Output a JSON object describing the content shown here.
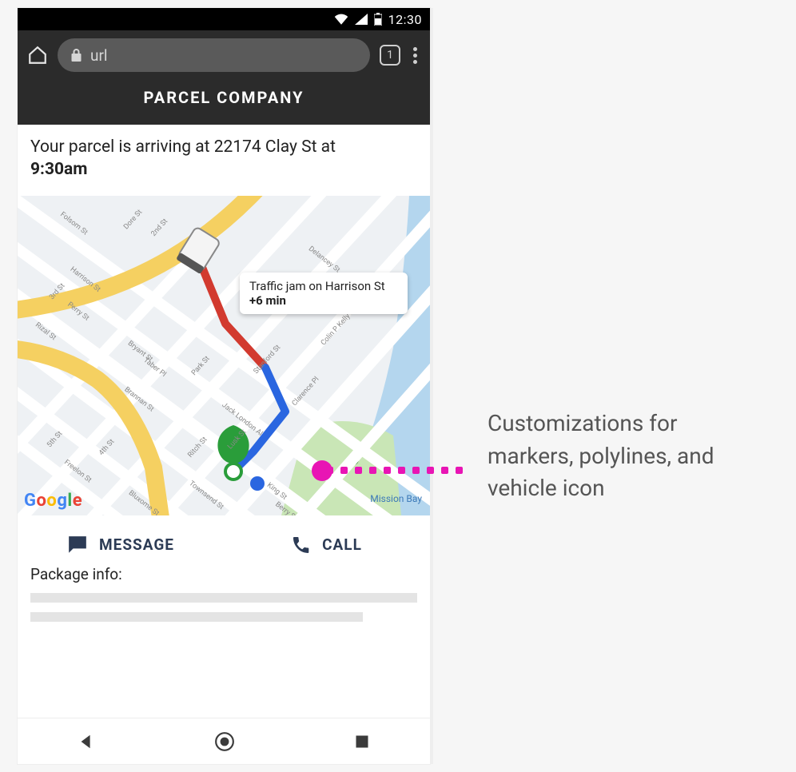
{
  "statusbar": {
    "time": "12:30"
  },
  "browser": {
    "url_placeholder": "url",
    "tab_count": "1"
  },
  "site": {
    "header": "PARCEL COMPANY"
  },
  "arrival": {
    "line1": "Your parcel is arriving at 22174 Clay St at",
    "time": "9:30am"
  },
  "map": {
    "traffic_alert_text": "Traffic jam on Harrison St",
    "traffic_delay": "+6 min",
    "logo": "Google",
    "area_label": "Mission Bay",
    "streets": [
      "Folsom St",
      "Dore St",
      "2nd St",
      "Harrison St",
      "Bryant St",
      "Taber Pl",
      "Brannan St",
      "Park St",
      "Stanford St",
      "Delancey St",
      "Rizal St",
      "Perry St",
      "3rd St",
      "4th St",
      "5th St",
      "Freelon St",
      "Townsend St",
      "Bluxome St",
      "Clarence Pl",
      "Ritch St",
      "King St",
      "Jack London Al",
      "Lusk St",
      "Colin P Kelly Jr St",
      "Berry St"
    ]
  },
  "actions": {
    "message_label": "MESSAGE",
    "call_label": "CALL"
  },
  "package": {
    "heading": "Package info:"
  },
  "annotation": {
    "text": "Customizations for markers, polylines, and vehicle icon"
  }
}
